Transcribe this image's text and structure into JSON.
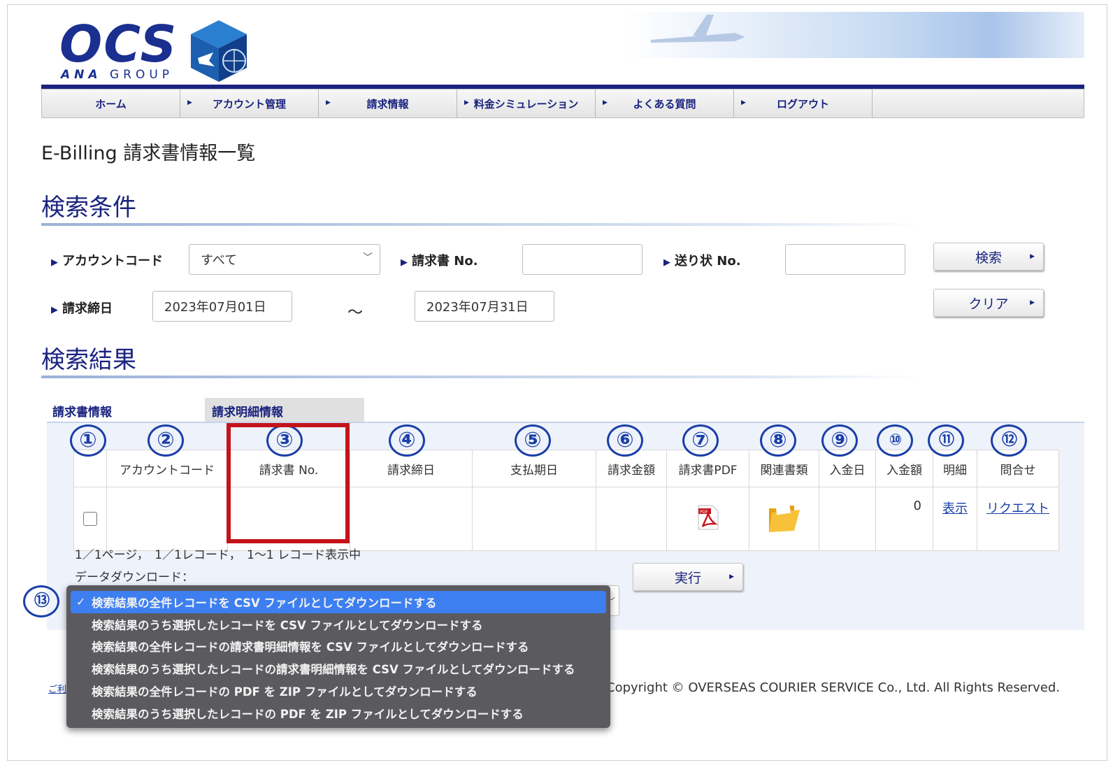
{
  "header": {
    "logo_text": "OCS",
    "logo_sub_brand": "ANA",
    "logo_sub_group": "GROUP",
    "nav": [
      {
        "label": "ホーム"
      },
      {
        "label": "アカウント管理"
      },
      {
        "label": "請求情報"
      },
      {
        "label": "料金シミュレーション"
      },
      {
        "label": "よくある質問"
      },
      {
        "label": "ログアウト"
      }
    ]
  },
  "page_title": "E-Billing 請求書情報一覧",
  "search": {
    "heading": "検索条件",
    "account_code_label": "アカウントコード",
    "account_code_value": "すべて",
    "invoice_no_label": "請求書 No.",
    "invoice_no_value": "",
    "waybill_no_label": "送り状 No.",
    "waybill_no_value": "",
    "closing_date_label": "請求締日",
    "date_from": "2023年07月01日",
    "date_to": "2023年07月31日",
    "tilde": "～",
    "search_button": "検索",
    "clear_button": "クリア"
  },
  "results": {
    "heading": "検索結果",
    "tabs": [
      "請求書情報",
      "請求明細情報"
    ],
    "callouts": [
      "①",
      "②",
      "③",
      "④",
      "⑤",
      "⑥",
      "⑦",
      "⑧",
      "⑨",
      "⑩",
      "⑪",
      "⑫",
      "⑬"
    ],
    "columns": [
      "",
      "アカウントコード",
      "請求書 No.",
      "請求締日",
      "支払期日",
      "請求金額",
      "請求書PDF",
      "関連書類",
      "入金日",
      "入金額",
      "明細",
      "問合せ"
    ],
    "row": {
      "account_code": "",
      "invoice_no": "",
      "closing_date": "",
      "due_date": "",
      "amount": "",
      "paid_date": "",
      "paid_amount": "0",
      "detail_link": "表示",
      "inquiry_link": "リクエスト"
    },
    "pdf_icon_text": "PDF",
    "status_text": "1／1ページ，　1／1レコード，　1～1 レコード表示中",
    "download_label": "データダウンロード：",
    "execute_button": "実行",
    "download_options": [
      "検索結果の全件レコードを CSV ファイルとしてダウンロードする",
      "検索結果のうち選択したレコードを CSV ファイルとしてダウンロードする",
      "検索結果の全件レコードの請求書明細情報を CSV ファイルとしてダウンロードする",
      "検索結果のうち選択したレコードの請求書明細情報を CSV ファイルとしてダウンロードする",
      "検索結果の全件レコードの PDF を ZIP ファイルとしてダウンロードする",
      "検索結果のうち選択したレコードの PDF を ZIP ファイルとしてダウンロードする"
    ],
    "selected_check": "✓"
  },
  "footer": {
    "left_link": "ご利",
    "copyright": "Copyright © OVERSEAS COURIER SERVICE Co., Ltd. All Rights Reserved."
  },
  "colors": {
    "brand_navy": "#1a237e",
    "callout_blue": "#1a3fa8",
    "highlight_red": "#c4131a",
    "dropdown_bg": "#5b5b5f",
    "dropdown_selected": "#3d7ff0"
  },
  "icons": [
    "logo-cube-icon",
    "triangle-right-icon",
    "chevron-down-icon",
    "pdf-icon",
    "folder-icon",
    "checkmark-icon"
  ]
}
